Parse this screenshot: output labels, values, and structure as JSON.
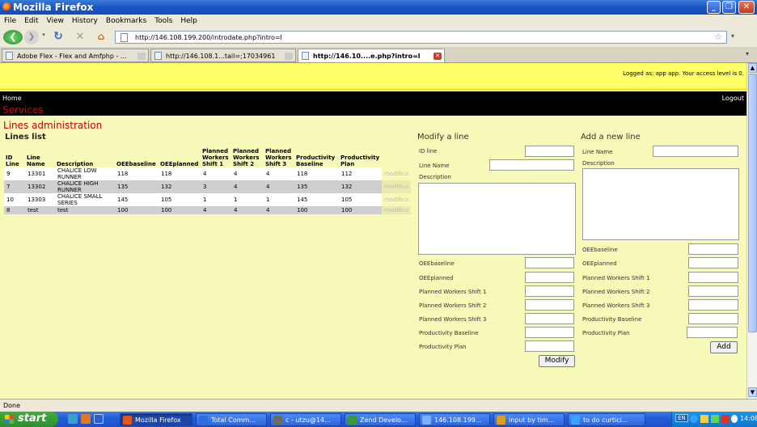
{
  "window": {
    "title": "Mozilla Firefox"
  },
  "menu": [
    "File",
    "Edit",
    "View",
    "History",
    "Bookmarks",
    "Tools",
    "Help"
  ],
  "nav": {
    "url": "http://146.108.199.200/introdate.php?intro=l"
  },
  "tabs": [
    {
      "label": "Adobe Flex - Flex and Amfphp - ..."
    },
    {
      "label": "http://146.108.1...tail=;17034961"
    },
    {
      "label": "http://146.10....e.php?intro=l"
    }
  ],
  "header": {
    "logged_text": "Logged as: app app. Your access level is 0.",
    "home": "Home",
    "services": "Services",
    "logout": "Logout"
  },
  "page": {
    "title": "Lines administration",
    "list_title": "Lines list"
  },
  "table": {
    "columns": [
      "ID Line",
      "Line Name",
      "Description",
      "OEEbaseline",
      "OEEplanned",
      "Planned Workers Shift 1",
      "Planned Workers Shift 2",
      "Planned Workers Shift 3",
      "Productivity Baseline",
      "Productivity Plan"
    ],
    "rows": [
      {
        "cells": [
          "9",
          "13301",
          "CHALICE LOW RUNNER",
          "118",
          "118",
          "4",
          "4",
          "4",
          "118",
          "112"
        ],
        "action": "modifica"
      },
      {
        "cells": [
          "7",
          "13302",
          "CHALICE HIGH RUNNER",
          "135",
          "132",
          "3",
          "4",
          "4",
          "135",
          "132"
        ],
        "action": "modifica"
      },
      {
        "cells": [
          "10",
          "13303",
          "CHALICE SMALL SERIES",
          "145",
          "105",
          "1",
          "1",
          "1",
          "145",
          "105"
        ],
        "action": "modifica"
      },
      {
        "cells": [
          "8",
          "test",
          "test",
          "100",
          "100",
          "4",
          "4",
          "4",
          "100",
          "100"
        ],
        "action": "modifica"
      }
    ]
  },
  "modify_form": {
    "title": "Modify a line",
    "id_label": "ID line",
    "name_label": "Line Name",
    "desc_label": "Description",
    "fields": [
      "OEEbaseline",
      "OEEplanned",
      "Planned Workers Shift 1",
      "Planned Workers Shift 2",
      "Planned Workers Shift 3",
      "Productivity Baseline",
      "Productivity Plan"
    ],
    "button": "Modify"
  },
  "add_form": {
    "title": "Add a new line",
    "name_label": "Line Name",
    "desc_label": "Description",
    "fields": [
      "OEEbaseline",
      "OEEplanned",
      "Planned Workers Shift 1",
      "Planned Workers Shift 2",
      "Planned Workers Shift 3",
      "Productivity Baseline",
      "Productivity Plan"
    ],
    "button": "Add"
  },
  "status": {
    "text": "Done"
  },
  "taskbar": {
    "start": "start",
    "buttons": [
      {
        "label": "Mozilla Firefox",
        "color": "#e0561b"
      },
      {
        "label": "Total Comm...",
        "color": "#2a6fdb"
      },
      {
        "label": "c - utzu@14...",
        "color": "#6a6a6a"
      },
      {
        "label": "Zend Develo...",
        "color": "#3a9a3a"
      },
      {
        "label": "146.108.199...",
        "color": "#7ab0ff"
      },
      {
        "label": "input by tim...",
        "color": "#d8a020"
      },
      {
        "label": "to do curtici...",
        "color": "#3aa0ff"
      }
    ],
    "lang": "EN",
    "clock": "14:08"
  }
}
